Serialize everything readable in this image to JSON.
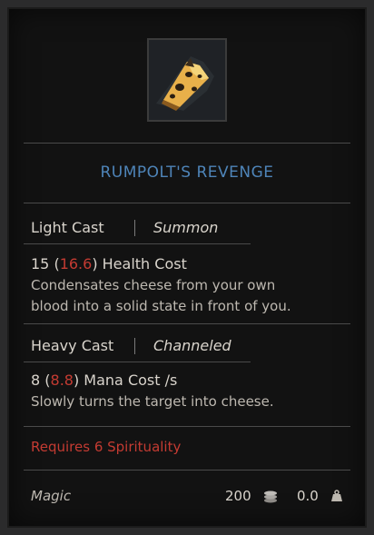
{
  "item": {
    "name": "RUMPOLT'S REVENGE",
    "icon": "cheese-icon"
  },
  "light_cast": {
    "label": "Light Cast",
    "type": "Summon",
    "cost_base": "15",
    "cost_bonus": "16.6",
    "cost_label": "Health Cost",
    "desc_line1": "Condensates cheese from your own",
    "desc_line2": "blood into a solid state in front of you."
  },
  "heavy_cast": {
    "label": "Heavy Cast",
    "type": "Channeled",
    "cost_base": "8",
    "cost_bonus": "8.8",
    "cost_label": "Mana Cost /s",
    "desc": "Slowly turns the target into cheese."
  },
  "requirement": "Requires 6 Spirituality",
  "footer": {
    "category": "Magic",
    "price": "200",
    "weight": "0.0",
    "coin_icon": "coins-icon",
    "weight_icon": "weight-icon"
  },
  "colors": {
    "title": "#4e84b8",
    "requirement": "#c43b32",
    "bonus": "#c43b32"
  }
}
